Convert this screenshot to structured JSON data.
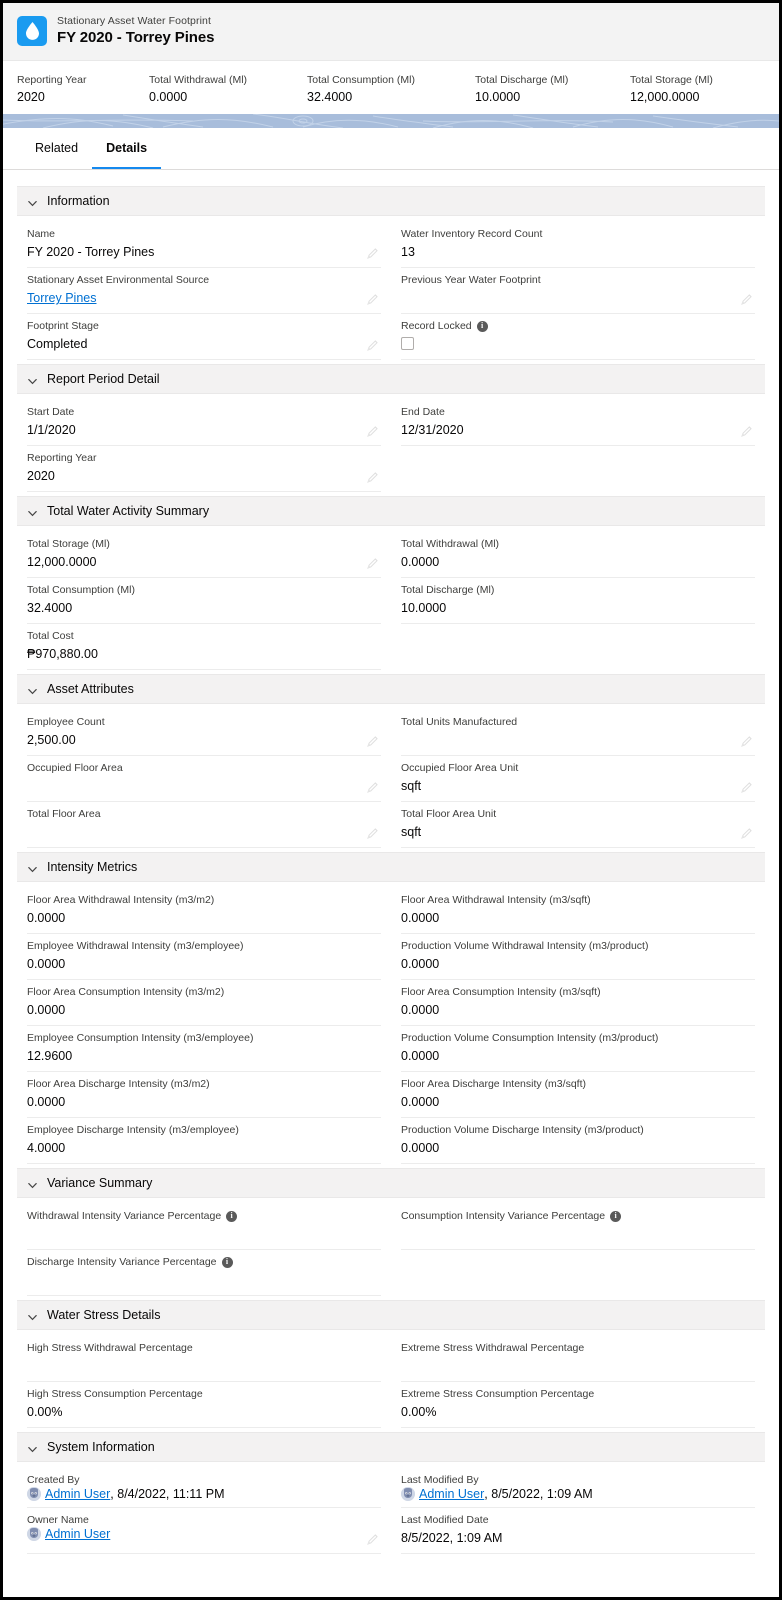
{
  "header": {
    "object_label": "Stationary Asset Water Footprint",
    "record_title": "FY 2020 - Torrey Pines",
    "icon": "water-drop-icon",
    "icon_color": "#1a9bf0",
    "highlights": [
      {
        "label": "Reporting Year",
        "value": "2020"
      },
      {
        "label": "Total Withdrawal (Ml)",
        "value": "0.0000"
      },
      {
        "label": "Total Consumption (Ml)",
        "value": "32.4000"
      },
      {
        "label": "Total Discharge (Ml)",
        "value": "10.0000"
      },
      {
        "label": "Total Storage (Ml)",
        "value": "12,000.0000"
      }
    ]
  },
  "tabs": [
    {
      "label": "Related",
      "active": false
    },
    {
      "label": "Details",
      "active": true
    }
  ],
  "sections": [
    {
      "title": "Information",
      "fields": [
        {
          "label": "Name",
          "value": "FY 2020 - Torrey Pines",
          "edit": true
        },
        {
          "label": "Water Inventory Record Count",
          "value": "13",
          "edit": false
        },
        {
          "label": "Stationary Asset Environmental Source",
          "value": "Torrey Pines",
          "link": true,
          "edit": true
        },
        {
          "label": "Previous Year Water Footprint",
          "value": "",
          "edit": true
        },
        {
          "label": "Footprint Stage",
          "value": "Completed",
          "edit": true
        },
        {
          "label": "Record Locked",
          "value": "",
          "info": true,
          "checkbox": true,
          "edit": false
        }
      ]
    },
    {
      "title": "Report Period Detail",
      "fields": [
        {
          "label": "Start Date",
          "value": "1/1/2020",
          "edit": true
        },
        {
          "label": "End Date",
          "value": "12/31/2020",
          "edit": true
        },
        {
          "label": "Reporting Year",
          "value": "2020",
          "edit": true
        },
        {
          "label": "",
          "value": "",
          "blank": true
        }
      ]
    },
    {
      "title": "Total Water Activity Summary",
      "fields": [
        {
          "label": "Total Storage (Ml)",
          "value": "12,000.0000",
          "edit": true
        },
        {
          "label": "Total Withdrawal (Ml)",
          "value": "0.0000",
          "edit": false
        },
        {
          "label": "Total Consumption (Ml)",
          "value": "32.4000",
          "edit": false
        },
        {
          "label": "Total Discharge (Ml)",
          "value": "10.0000",
          "edit": false
        },
        {
          "label": "Total Cost",
          "value": "₱970,880.00",
          "edit": false
        },
        {
          "label": "",
          "value": "",
          "blank": true
        }
      ]
    },
    {
      "title": "Asset Attributes",
      "fields": [
        {
          "label": "Employee Count",
          "value": "2,500.00",
          "edit": true
        },
        {
          "label": "Total Units Manufactured",
          "value": "",
          "edit": true
        },
        {
          "label": "Occupied Floor Area",
          "value": "",
          "edit": true
        },
        {
          "label": "Occupied Floor Area Unit",
          "value": "sqft",
          "edit": true
        },
        {
          "label": "Total Floor Area",
          "value": "",
          "edit": true
        },
        {
          "label": "Total Floor Area Unit",
          "value": "sqft",
          "edit": true
        }
      ]
    },
    {
      "title": "Intensity Metrics",
      "fields": [
        {
          "label": "Floor Area Withdrawal Intensity (m3/m2)",
          "value": "0.0000",
          "edit": false
        },
        {
          "label": "Floor Area Withdrawal Intensity (m3/sqft)",
          "value": "0.0000",
          "edit": false
        },
        {
          "label": "Employee Withdrawal Intensity (m3/employee)",
          "value": "0.0000",
          "edit": false
        },
        {
          "label": "Production Volume Withdrawal Intensity (m3/product)",
          "value": "0.0000",
          "edit": false
        },
        {
          "label": "Floor Area Consumption Intensity (m3/m2)",
          "value": "0.0000",
          "edit": false
        },
        {
          "label": "Floor Area Consumption Intensity (m3/sqft)",
          "value": "0.0000",
          "edit": false
        },
        {
          "label": "Employee Consumption Intensity (m3/employee)",
          "value": "12.9600",
          "edit": false
        },
        {
          "label": "Production Volume Consumption Intensity (m3/product)",
          "value": "0.0000",
          "edit": false
        },
        {
          "label": "Floor Area Discharge Intensity (m3/m2)",
          "value": "0.0000",
          "edit": false
        },
        {
          "label": "Floor Area Discharge Intensity (m3/sqft)",
          "value": "0.0000",
          "edit": false
        },
        {
          "label": "Employee Discharge Intensity (m3/employee)",
          "value": "4.0000",
          "edit": false
        },
        {
          "label": "Production Volume Discharge Intensity (m3/product)",
          "value": "0.0000",
          "edit": false
        }
      ]
    },
    {
      "title": "Variance Summary",
      "fields": [
        {
          "label": "Withdrawal Intensity Variance Percentage",
          "value": "",
          "info": true,
          "edit": false
        },
        {
          "label": "Consumption Intensity Variance Percentage",
          "value": "",
          "info": true,
          "edit": false
        },
        {
          "label": "Discharge Intensity Variance Percentage",
          "value": "",
          "info": true,
          "edit": false
        },
        {
          "label": "",
          "value": "",
          "blank": true
        }
      ]
    },
    {
      "title": "Water Stress Details",
      "fields": [
        {
          "label": "High Stress Withdrawal Percentage",
          "value": "",
          "edit": false
        },
        {
          "label": "Extreme Stress Withdrawal Percentage",
          "value": "",
          "edit": false
        },
        {
          "label": "High Stress Consumption Percentage",
          "value": "0.00%",
          "edit": false
        },
        {
          "label": "Extreme Stress Consumption Percentage",
          "value": "0.00%",
          "edit": false
        }
      ]
    },
    {
      "title": "System Information",
      "fields": [
        {
          "label": "Created By",
          "user": "Admin User",
          "value": ", 8/4/2022, 11:11 PM",
          "avatar": true,
          "edit": false
        },
        {
          "label": "Last Modified By",
          "user": "Admin User",
          "value": ", 8/5/2022, 1:09 AM",
          "avatar": true,
          "edit": false
        },
        {
          "label": "Owner Name",
          "user": "Admin User",
          "value": "",
          "avatar": true,
          "edit": true
        },
        {
          "label": "Last Modified Date",
          "value": "8/5/2022, 1:09 AM",
          "edit": false
        }
      ]
    }
  ],
  "colors": {
    "accent": "#1589ee",
    "link": "#0070d2",
    "icon_bg": "#1a9bf0",
    "banner": "#a8bddb",
    "section_bg": "#f3f2f2"
  }
}
